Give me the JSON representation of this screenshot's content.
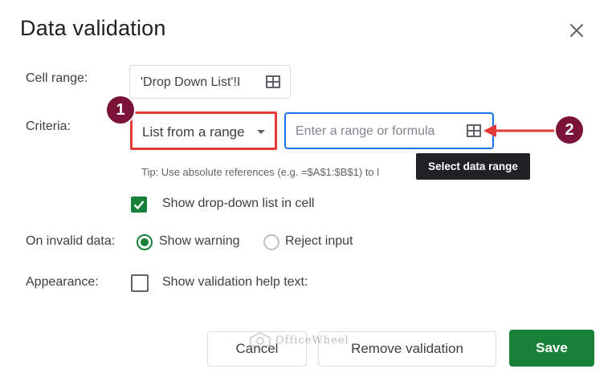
{
  "dialog": {
    "title": "Data validation",
    "close_icon": "close-icon"
  },
  "cell_range": {
    "label": "Cell range:",
    "value": "'Drop Down List'!I",
    "icon": "grid-select-icon"
  },
  "criteria": {
    "label": "Criteria:",
    "selected": "List from a range",
    "input_placeholder": "Enter a range or formula",
    "input_value": "",
    "icon": "grid-select-icon",
    "tip": "Tip: Use absolute references (e.g. =$A$1:$B$1) to l",
    "tooltip": "Select data range"
  },
  "annotations": {
    "marker_1": "1",
    "marker_2": "2",
    "highlight_color": "#e53935",
    "marker_color": "#7b1238"
  },
  "options": {
    "show_dropdown_label": "Show drop-down list in cell",
    "show_dropdown_checked": true
  },
  "invalid_data": {
    "label": "On invalid data:",
    "show_warning": "Show warning",
    "reject_input": "Reject input",
    "selected": "Show warning"
  },
  "appearance": {
    "label": "Appearance:",
    "help_text_label": "Show validation help text:",
    "help_text_checked": false
  },
  "buttons": {
    "cancel": "Cancel",
    "remove": "Remove validation",
    "save": "Save"
  },
  "watermark": {
    "text": "OfficeWheel",
    "icon": "officewheel-logo-icon"
  },
  "colors": {
    "accent": "#188038",
    "focus": "#1a73e8",
    "tooltip_bg": "#202124"
  }
}
